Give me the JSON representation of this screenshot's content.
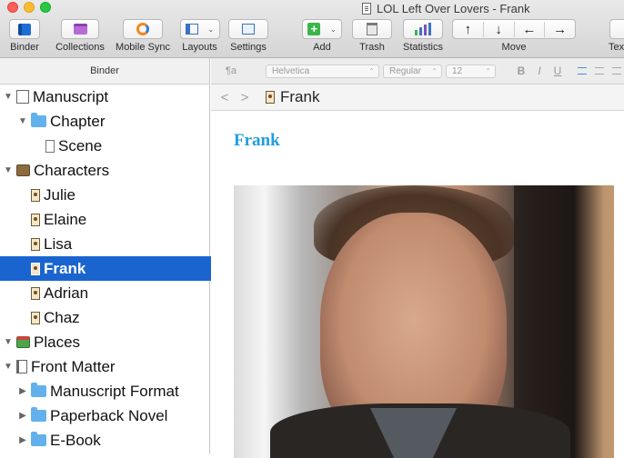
{
  "window": {
    "title": "LOL Left Over Lovers - Frank"
  },
  "toolbar": {
    "items": [
      {
        "label": "Binder"
      },
      {
        "label": "Collections"
      },
      {
        "label": "Mobile Sync"
      },
      {
        "label": "Layouts"
      },
      {
        "label": "Settings"
      },
      {
        "label": "Add"
      },
      {
        "label": "Trash"
      },
      {
        "label": "Statistics"
      },
      {
        "label": "Move"
      },
      {
        "label": "Tex"
      }
    ],
    "move_arrows": [
      "↑",
      "↓",
      "←",
      "→"
    ]
  },
  "binder": {
    "header": "Binder",
    "rows": [
      {
        "label": "Manuscript"
      },
      {
        "label": "Chapter"
      },
      {
        "label": "Scene"
      },
      {
        "label": "Characters"
      },
      {
        "label": "Julie"
      },
      {
        "label": "Elaine"
      },
      {
        "label": "Lisa"
      },
      {
        "label": "Frank"
      },
      {
        "label": "Adrian"
      },
      {
        "label": "Chaz"
      },
      {
        "label": "Places"
      },
      {
        "label": "Front Matter"
      },
      {
        "label": "Manuscript Format"
      },
      {
        "label": "Paperback Novel"
      },
      {
        "label": "E-Book"
      }
    ]
  },
  "formatbar": {
    "paragraph": "¶a",
    "font": "Helvetica",
    "style": "Regular",
    "size": "12",
    "bold": "B",
    "italic": "I",
    "underline": "U"
  },
  "navbar": {
    "back": "<",
    "forward": ">",
    "title": "Frank"
  },
  "editor": {
    "heading": "Frank"
  }
}
